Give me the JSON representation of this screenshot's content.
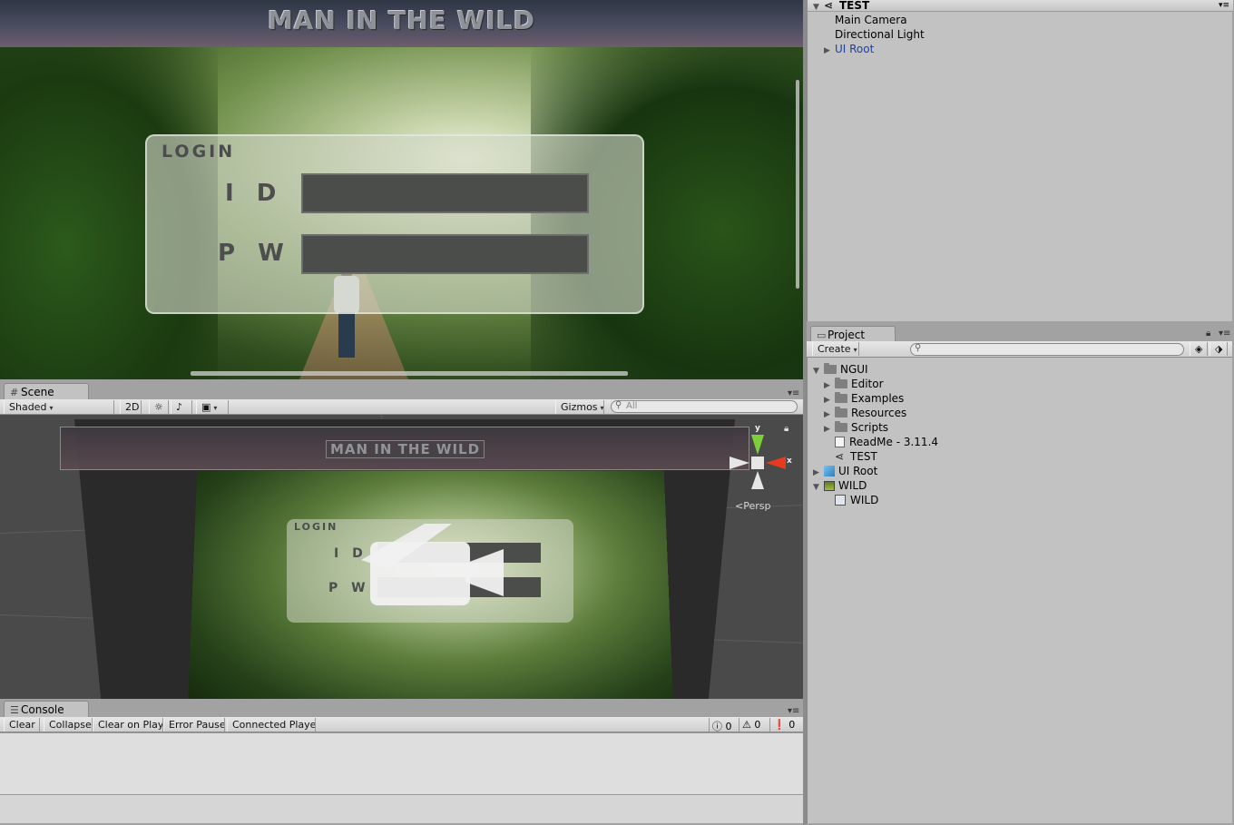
{
  "game": {
    "banner_title": "MAN IN THE WILD",
    "login_label": "LOGIN",
    "id_label": "I D",
    "pw_label": "P W"
  },
  "scene": {
    "tab_label": "Scene",
    "shading_mode": "Shaded",
    "mode_2d": "2D",
    "gizmos_label": "Gizmos",
    "search_placeholder": "All",
    "banner_title": "MAN IN THE WILD",
    "login_label": "LOGIN",
    "id_label": "I D",
    "pw_label": "P W",
    "axis_y": "y",
    "axis_x": "x",
    "projection": "Persp"
  },
  "console": {
    "tab_label": "Console",
    "buttons": [
      "Clear",
      "Collapse",
      "Clear on Play",
      "Error Pause",
      "Connected Playe"
    ],
    "log_count": "0",
    "warning_count": "0",
    "error_count": "0"
  },
  "hierarchy": {
    "scene_name": "TEST",
    "items": [
      {
        "label": "Main Camera"
      },
      {
        "label": "Directional Light"
      },
      {
        "label": "UI Root"
      }
    ]
  },
  "project": {
    "tab_label": "Project",
    "create_label": "Create",
    "tree": [
      {
        "label": "NGUI"
      },
      {
        "label": "Editor"
      },
      {
        "label": "Examples"
      },
      {
        "label": "Resources"
      },
      {
        "label": "Scripts"
      },
      {
        "label": "ReadMe - 3.11.4"
      },
      {
        "label": "TEST"
      },
      {
        "label": "UI Root"
      },
      {
        "label": "WILD"
      },
      {
        "label": "WILD"
      }
    ]
  },
  "colors": {
    "accent_blue": "#1d3fa8",
    "axis_x": "#e83a1e",
    "axis_y": "#7ed03b"
  }
}
